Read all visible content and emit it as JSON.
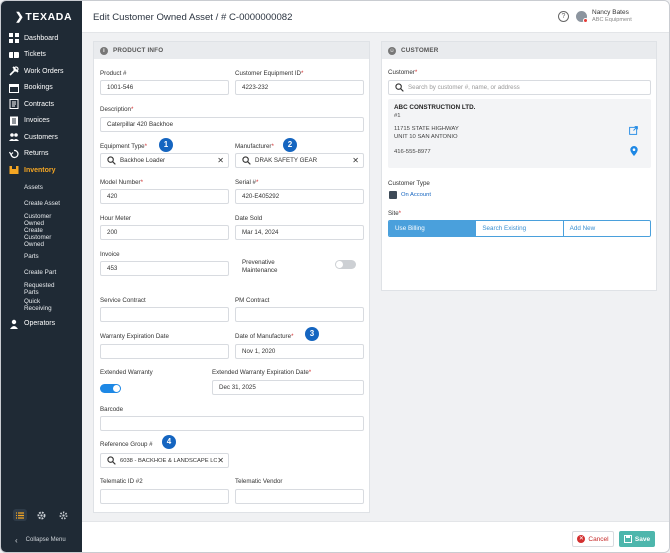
{
  "app": {
    "logo": "TEXADA",
    "page_title": "Edit Customer Owned Asset / # C-0000000082"
  },
  "user": {
    "name": "Nancy Bates",
    "company": "ABC Equipment"
  },
  "sidebar": {
    "items": [
      {
        "label": "Dashboard",
        "icon": "dashboard-icon"
      },
      {
        "label": "Tickets",
        "icon": "ticket-icon"
      },
      {
        "label": "Work Orders",
        "icon": "wrench-icon"
      },
      {
        "label": "Bookings",
        "icon": "calendar-icon"
      },
      {
        "label": "Contracts",
        "icon": "contract-icon"
      },
      {
        "label": "Invoices",
        "icon": "invoice-icon"
      },
      {
        "label": "Customers",
        "icon": "customers-icon"
      },
      {
        "label": "Returns",
        "icon": "return-icon"
      },
      {
        "label": "Inventory",
        "icon": "inventory-icon",
        "active": true
      }
    ],
    "subitems": [
      "Assets",
      "Create Asset",
      "Customer Owned",
      "Create Customer Owned",
      "Parts",
      "Create Part",
      "Requested Parts",
      "Quick Receiving"
    ],
    "operators": "Operators",
    "collapse": "Collapse Menu",
    "accent": "#f5a623"
  },
  "product": {
    "title": "PRODUCT INFO",
    "product_no_label": "Product #",
    "product_no": "1001-546",
    "cust_equip_label": "Customer Equipment ID",
    "cust_equip": "4223-232",
    "description_label": "Description",
    "description": "Caterpillar 420 Backhoe",
    "equip_type_label": "Equipment Type",
    "equip_type": "Backhoe Loader",
    "manufacturer_label": "Manufacturer",
    "manufacturer": "DRAK SAFETY GEAR",
    "model_label": "Model Number",
    "model": "420",
    "serial_label": "Serial #",
    "serial": "420-E405292",
    "hour_label": "Hour Meter",
    "hour": "200",
    "date_sold_label": "Date Sold",
    "date_sold": "Mar 14, 2024",
    "invoice_label": "Invoice",
    "invoice": "453",
    "prev_maint_label": "Prevenative Maintenance",
    "service_label": "Service Contract",
    "service": "",
    "pm_label": "PM Contract",
    "pm": "",
    "warranty_exp_label": "Warranty Expiration Date",
    "warranty_exp": "",
    "manufacture_label": "Date of Manufacture",
    "manufacture": "Nov 1, 2020",
    "ext_warranty_label": "Extended Warranty",
    "ext_warranty_exp_label": "Extended Warranty Expiration Date",
    "ext_warranty_exp": "Dec 31, 2025",
    "barcode_label": "Barcode",
    "barcode": "",
    "ref_group_label": "Reference Group #",
    "ref_group": "6038 - BACKHOE & LANDSCAPE LOA",
    "telematic_id_label": "Telematic ID #2",
    "telematic_id": "",
    "telematic_vendor_label": "Telematic Vendor",
    "telematic_vendor": ""
  },
  "badges": [
    "1",
    "2",
    "3",
    "4"
  ],
  "customer": {
    "title": "CUSTOMER",
    "customer_label": "Customer",
    "search_placeholder": "Search by customer #, name, or address",
    "name": "ABC CONSTRUCTION LTD.",
    "number": "#1",
    "address1": "11715 STATE HIGHWAY",
    "address2": "UNIT 10 SAN ANTONIO",
    "phone": "416-555-8977",
    "type_label": "Customer Type",
    "type": "On Account",
    "site_label": "Site",
    "site_options": [
      "Use Billing",
      "Search Existing",
      "Add New"
    ]
  },
  "footer": {
    "cancel": "Cancel",
    "save": "Save"
  },
  "colors": {
    "primary_blue": "#1565c0",
    "save": "#4db6ac",
    "cancel": "#c62828",
    "toggle_on": "#1e88e5"
  }
}
